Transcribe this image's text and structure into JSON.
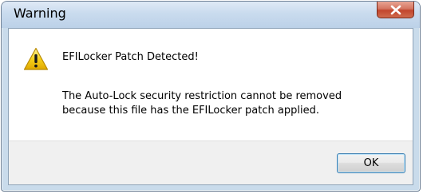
{
  "window": {
    "title": "Warning",
    "close_icon": "close-icon"
  },
  "message": {
    "icon": "warning-icon",
    "heading": "EFILocker Patch Detected!",
    "body_lines": [
      "The Auto-Lock security restriction cannot be removed",
      "because this file has the EFILocker patch applied."
    ]
  },
  "buttons": {
    "ok_label": "OK"
  },
  "colors": {
    "title_bar": "#c9dbee",
    "close_button": "#c2452c",
    "warning_yellow": "#f5c400",
    "button_focus_border": "#3c7fb1"
  }
}
